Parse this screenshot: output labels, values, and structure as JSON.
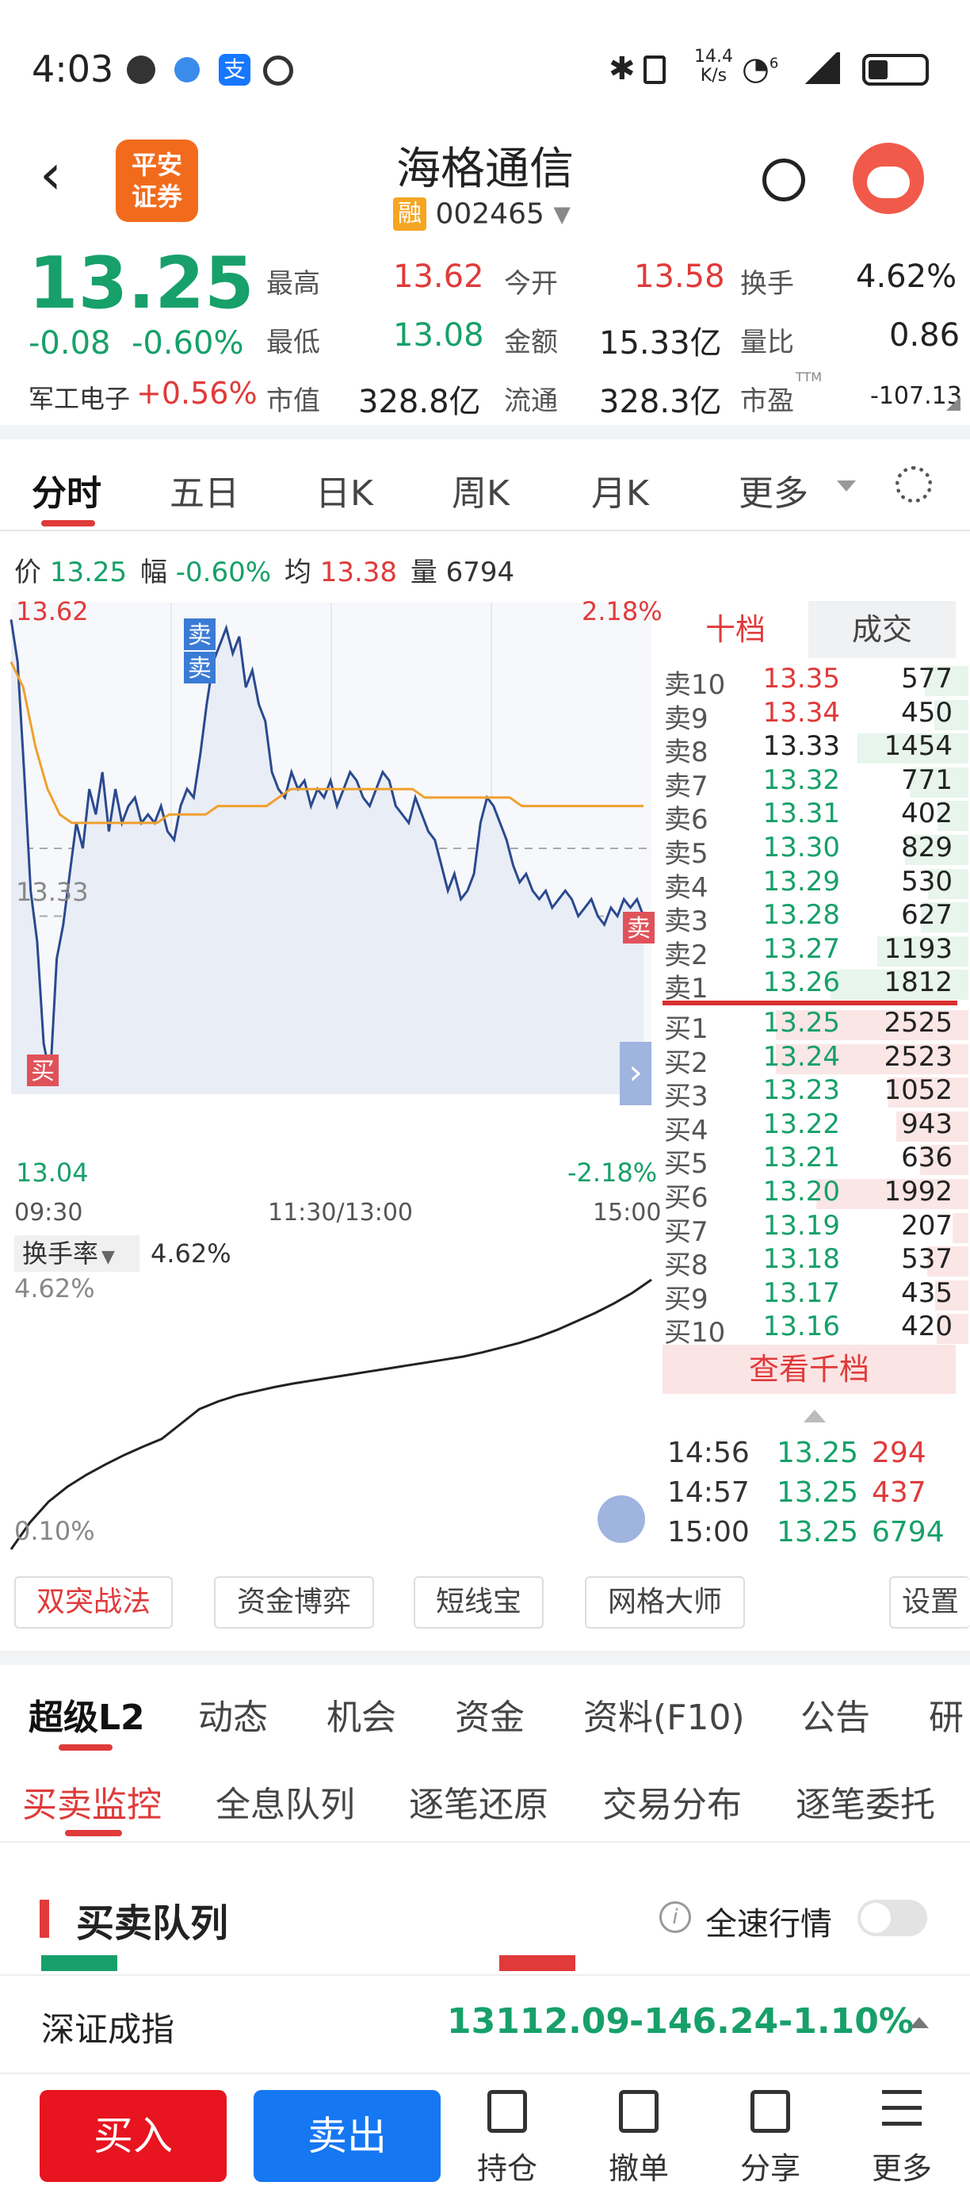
{
  "status_bar": {
    "time": "4:03",
    "speed_top": "14.4",
    "speed_unit": "K/s",
    "net": "6"
  },
  "header": {
    "brand_line1": "平安",
    "brand_line2": "证券",
    "title": "海格通信",
    "margin_tag": "融",
    "code": "002465"
  },
  "quote": {
    "price": "13.25",
    "change": "-0.08",
    "change_pct": "-0.60%",
    "sector": "军工电子",
    "sector_pct": "+0.56%",
    "high_label": "最高",
    "high": "13.62",
    "open_label": "今开",
    "open": "13.58",
    "turnover_label": "换手",
    "turnover": "4.62%",
    "low_label": "最低",
    "low": "13.08",
    "amount_label": "金额",
    "amount": "15.33亿",
    "volratio_label": "量比",
    "volratio": "0.86",
    "mcap_label": "市值",
    "mcap": "328.8亿",
    "float_label": "流通",
    "float": "328.3亿",
    "pe_label": "市盈",
    "pe_sup": "TTM",
    "pe": "-107.13"
  },
  "chart_tabs": [
    "分时",
    "五日",
    "日K",
    "周K",
    "月K",
    "更多"
  ],
  "info_line": {
    "price_label": "价",
    "price": "13.25",
    "range_label": "幅",
    "range": "-0.60%",
    "avg_label": "均",
    "avg": "13.38",
    "vol_label": "量",
    "vol": "6794"
  },
  "chart_data": [
    {
      "type": "line",
      "title": "",
      "x_ticks": [
        "09:30",
        "11:30/13:00",
        "15:00"
      ],
      "y_top": "13.62",
      "y_mid": "13.33",
      "y_bottom": "13.04",
      "pct_top": "2.18%",
      "pct_bottom": "-2.18%",
      "ylim": [
        13.04,
        13.62
      ],
      "series": [
        {
          "name": "",
          "values": [
            13.6,
            13.55,
            13.42,
            13.28,
            13.22,
            13.1,
            13.06,
            13.2,
            13.24,
            13.3,
            13.36,
            13.33,
            13.4,
            13.37,
            13.42,
            13.35,
            13.4,
            13.36,
            13.38,
            13.39,
            13.36,
            13.37,
            13.36,
            13.38,
            13.35,
            13.34,
            13.38,
            13.4,
            13.39,
            13.44,
            13.5,
            13.55,
            13.57,
            13.59,
            13.56,
            13.58,
            13.52,
            13.54,
            13.5,
            13.48,
            13.42,
            13.4,
            13.39,
            13.42,
            13.4,
            13.41,
            13.38,
            13.4,
            13.39,
            13.41,
            13.38,
            13.4,
            13.42,
            13.41,
            13.39,
            13.38,
            13.4,
            13.42,
            13.41,
            13.38,
            13.37,
            13.36,
            13.39,
            13.37,
            13.35,
            13.34,
            13.31,
            13.28,
            13.3,
            13.27,
            13.28,
            13.3,
            13.36,
            13.39,
            13.38,
            13.36,
            13.34,
            13.31,
            13.29,
            13.3,
            13.28,
            13.27,
            13.28,
            13.26,
            13.27,
            13.28,
            13.27,
            13.25,
            13.26,
            13.27,
            13.25,
            13.24,
            13.26,
            13.25,
            13.27,
            13.26,
            13.27,
            13.25
          ]
        },
        {
          "name": "",
          "values": [
            13.55,
            13.52,
            13.45,
            13.4,
            13.37,
            13.36,
            13.36,
            13.36,
            13.36,
            13.36,
            13.36,
            13.36,
            13.36,
            13.37,
            13.37,
            13.37,
            13.37,
            13.38,
            13.38,
            13.38,
            13.38,
            13.38,
            13.39,
            13.4,
            13.4,
            13.4,
            13.4,
            13.4,
            13.4,
            13.4,
            13.4,
            13.4,
            13.4,
            13.4,
            13.39,
            13.39,
            13.39,
            13.39,
            13.39,
            13.39,
            13.39,
            13.39,
            13.38,
            13.38,
            13.38,
            13.38,
            13.38,
            13.38,
            13.38,
            13.38,
            13.38,
            13.38,
            13.38
          ]
        }
      ],
      "markers": [
        {
          "label": "卖"
        },
        {
          "label": "卖"
        },
        {
          "label": "买"
        },
        {
          "label": "卖"
        }
      ]
    },
    {
      "type": "line",
      "title": "",
      "label": "换手率",
      "value": "4.62%",
      "y_top": "4.62%",
      "y_bottom": "0.10%",
      "ylim": [
        0.1,
        4.62
      ],
      "series": [
        {
          "name": "换手率",
          "values": [
            0.1,
            0.55,
            0.9,
            1.15,
            1.35,
            1.52,
            1.68,
            1.82,
            1.95,
            2.2,
            2.45,
            2.58,
            2.68,
            2.75,
            2.82,
            2.88,
            2.93,
            2.98,
            3.03,
            3.08,
            3.13,
            3.18,
            3.23,
            3.28,
            3.33,
            3.4,
            3.48,
            3.56,
            3.66,
            3.78,
            3.92,
            4.06,
            4.22,
            4.4,
            4.62
          ]
        }
      ]
    }
  ],
  "orderbook": {
    "tab_active": "十档",
    "tab_other": "成交",
    "asks": [
      [
        "卖10",
        "13.35",
        "577"
      ],
      [
        "卖9",
        "13.34",
        "450"
      ],
      [
        "卖8",
        "13.33",
        "1454"
      ],
      [
        "卖7",
        "13.32",
        "771"
      ],
      [
        "卖6",
        "13.31",
        "402"
      ],
      [
        "卖5",
        "13.30",
        "829"
      ],
      [
        "卖4",
        "13.29",
        "530"
      ],
      [
        "卖3",
        "13.28",
        "627"
      ],
      [
        "卖2",
        "13.27",
        "1193"
      ],
      [
        "卖1",
        "13.26",
        "1812"
      ]
    ],
    "bids": [
      [
        "买1",
        "13.25",
        "2525"
      ],
      [
        "买2",
        "13.24",
        "2523"
      ],
      [
        "买3",
        "13.23",
        "1052"
      ],
      [
        "买4",
        "13.22",
        "943"
      ],
      [
        "买5",
        "13.21",
        "636"
      ],
      [
        "买6",
        "13.20",
        "1992"
      ],
      [
        "买7",
        "13.19",
        "207"
      ],
      [
        "买8",
        "13.18",
        "537"
      ],
      [
        "买9",
        "13.17",
        "435"
      ],
      [
        "买10",
        "13.16",
        "420"
      ]
    ],
    "view_more": "查看千档",
    "trades": [
      [
        "14:56",
        "13.25",
        "294"
      ],
      [
        "14:57",
        "13.25",
        "437"
      ],
      [
        "15:00",
        "13.25",
        "6794"
      ]
    ]
  },
  "tools": [
    "双突战法",
    "资金博弈",
    "短线宝",
    "网格大师",
    "设置"
  ],
  "section_tabs": [
    "超级L2",
    "动态",
    "机会",
    "资金",
    "资料(F10)",
    "公告",
    "研"
  ],
  "sub_tabs": [
    "买卖监控",
    "全息队列",
    "逐笔还原",
    "交易分布",
    "逐笔委托"
  ],
  "queue": {
    "title": "买卖队列",
    "toggle_label": "全速行情"
  },
  "index": {
    "name": "深证成指",
    "value": "13112.09",
    "change": "-146.24",
    "pct": "-1.10%"
  },
  "bottom": {
    "buy": "买入",
    "sell": "卖出",
    "items": [
      "持仓",
      "撤单",
      "分享",
      "更多"
    ]
  }
}
